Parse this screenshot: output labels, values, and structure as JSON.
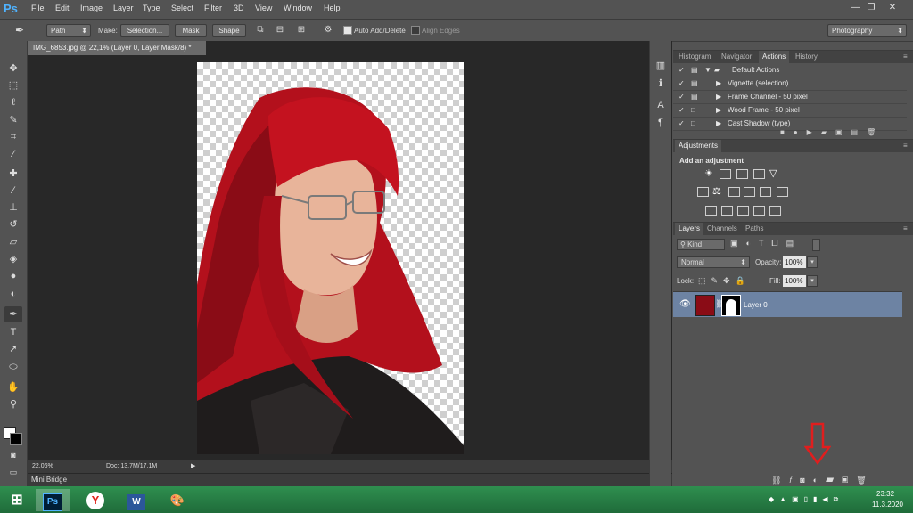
{
  "app": {
    "logo": "Ps"
  },
  "menu": [
    "File",
    "Edit",
    "Image",
    "Layer",
    "Type",
    "Select",
    "Filter",
    "3D",
    "View",
    "Window",
    "Help"
  ],
  "window_controls": {
    "minimize": "—",
    "restore": "❐",
    "close": "✕"
  },
  "options": {
    "tool_mode": "Path",
    "make_label": "Make:",
    "selection_btn": "Selection...",
    "mask_btn": "Mask",
    "shape_btn": "Shape",
    "auto_add_delete": "Auto Add/Delete",
    "align_edges": "Align Edges",
    "workspace": "Photography"
  },
  "document": {
    "tab_title": "IMG_6853.jpg @ 22,1% (Layer 0, Layer Mask/8) *",
    "zoom": "22,06%",
    "doc_size": "Doc: 13,7M/17,1M"
  },
  "mini_bridge": "Mini Bridge",
  "actions_panel": {
    "tabs": [
      "Histogram",
      "Navigator",
      "Actions",
      "History"
    ],
    "active_tab": "Actions",
    "rows": [
      "Default Actions",
      "Vignette (selection)",
      "Frame Channel - 50 pixel",
      "Wood Frame - 50 pixel",
      "Cast Shadow (type)"
    ]
  },
  "adjustments_panel": {
    "tab": "Adjustments",
    "title": "Add an adjustment"
  },
  "layers_panel": {
    "tabs": [
      "Layers",
      "Channels",
      "Paths"
    ],
    "active_tab": "Layers",
    "kind_filter": "Kind",
    "blend_mode": "Normal",
    "opacity_label": "Opacity:",
    "opacity_value": "100%",
    "lock_label": "Lock:",
    "fill_label": "Fill:",
    "fill_value": "100%",
    "layers": [
      {
        "name": "Layer 0"
      }
    ]
  },
  "taskbar": {
    "time": "23:32",
    "date": "11.3.2020"
  },
  "colors": {
    "accent_arrow": "#e01e1e",
    "selected_layer": "#6d83a3",
    "taskbar": "#2a8048"
  }
}
